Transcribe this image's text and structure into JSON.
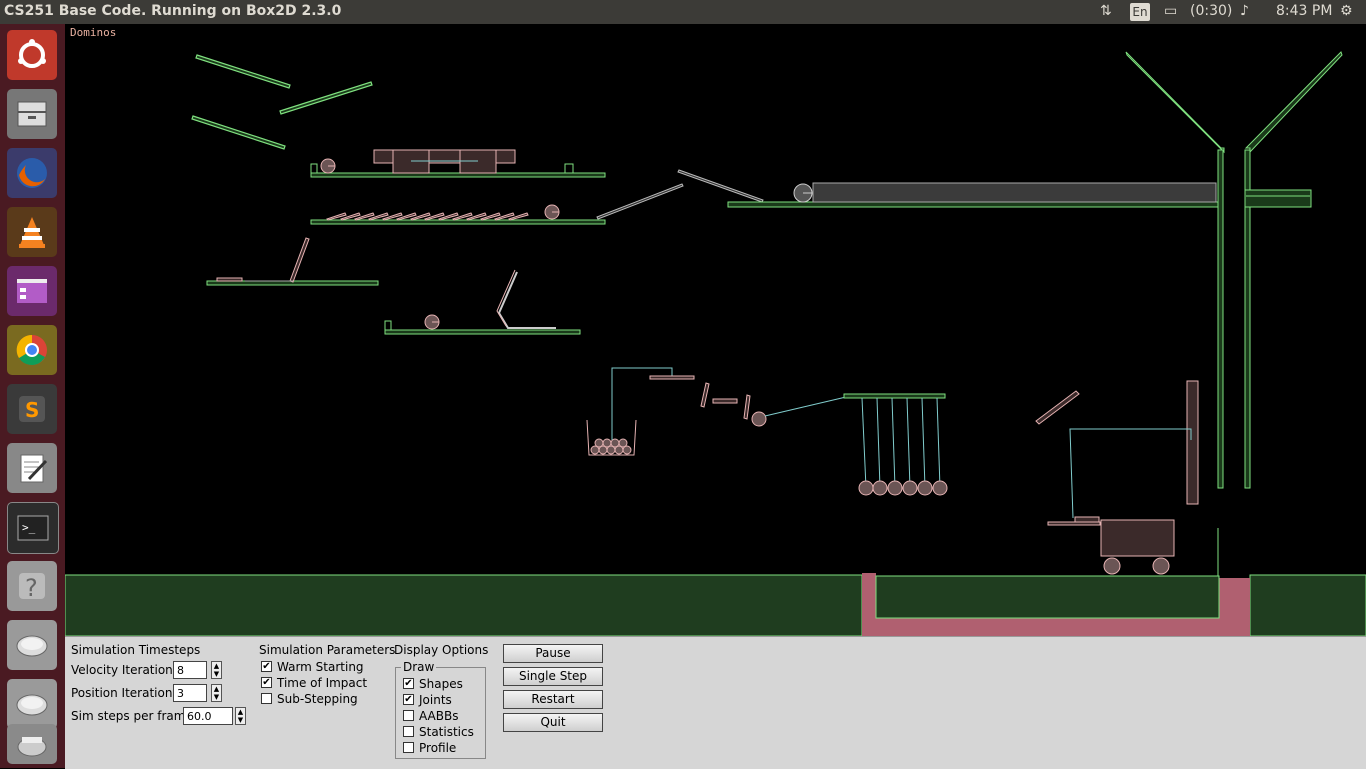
{
  "window": {
    "title": "CS251 Base Code. Running on Box2D 2.3.0"
  },
  "indicators": {
    "lang": "En",
    "battery": "(0:30)",
    "time": "8:43 PM"
  },
  "launcher": {
    "items": [
      {
        "name": "ubuntu-dash-icon"
      },
      {
        "name": "files-icon"
      },
      {
        "name": "firefox-icon"
      },
      {
        "name": "vlc-icon"
      },
      {
        "name": "app-window-icon"
      },
      {
        "name": "chrome-icon"
      },
      {
        "name": "sublime-text-icon"
      },
      {
        "name": "text-editor-icon"
      },
      {
        "name": "terminal-icon"
      },
      {
        "name": "help-icon"
      },
      {
        "name": "drive-icon"
      },
      {
        "name": "drive-icon"
      },
      {
        "name": "trash-icon"
      }
    ]
  },
  "scene": {
    "name": "Dominos",
    "colors": {
      "static": "#7fe07f",
      "dynamic": "#e6b3b3",
      "joint": "#80cccc",
      "ground": "#1f3d1f",
      "sand": "#b06070"
    }
  },
  "panel": {
    "timesteps": {
      "header": "Simulation Timesteps",
      "velocity_label": "Velocity Iterations",
      "velocity_value": "8",
      "position_label": "Position Iterations",
      "position_value": "3",
      "sim_label": "Sim steps per frame",
      "sim_value": "60.0"
    },
    "params": {
      "header": "Simulation Parameters",
      "warm": {
        "label": "Warm Starting",
        "checked": true
      },
      "toi": {
        "label": "Time of Impact",
        "checked": true
      },
      "substep": {
        "label": "Sub-Stepping",
        "checked": false
      }
    },
    "display": {
      "header": "Display Options",
      "group": "Draw",
      "shapes": {
        "label": "Shapes",
        "checked": true
      },
      "joints": {
        "label": "Joints",
        "checked": true
      },
      "aabbs": {
        "label": "AABBs",
        "checked": false
      },
      "stats": {
        "label": "Statistics",
        "checked": false
      },
      "profile": {
        "label": "Profile",
        "checked": false
      }
    },
    "buttons": {
      "pause": "Pause",
      "single_step": "Single Step",
      "restart": "Restart",
      "quit": "Quit"
    }
  }
}
